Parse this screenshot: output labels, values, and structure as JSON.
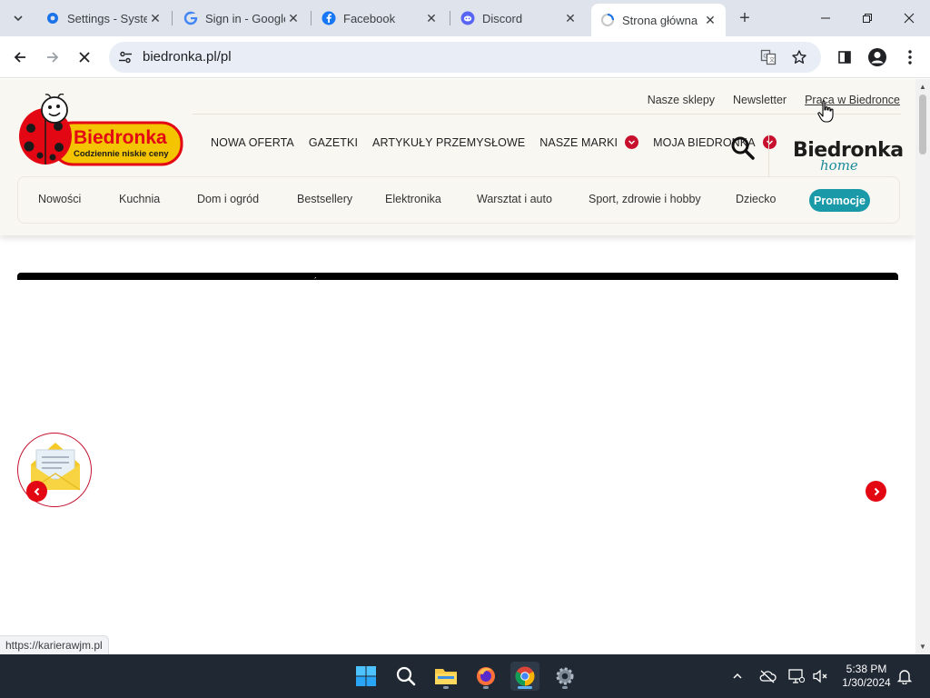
{
  "browser": {
    "tabs": [
      {
        "title": "Settings - System",
        "icon": "settings-gear-icon"
      },
      {
        "title": "Sign in - Google",
        "icon": "google-g-icon"
      },
      {
        "title": "Facebook",
        "icon": "facebook-icon"
      },
      {
        "title": "Discord",
        "icon": "discord-icon"
      },
      {
        "title": "Strona główna",
        "icon": "loading-favicon-icon",
        "active": true
      }
    ],
    "new_tab": "+",
    "url": "biedronka.pl/pl",
    "status_url": "https://karierawjm.pl"
  },
  "site": {
    "logo": {
      "brand": "Biedronka",
      "tagline": "Codziennie niskie ceny"
    },
    "util_links": [
      "Nasze sklepy",
      "Newsletter",
      "Praca w Biedronce"
    ],
    "main_nav": [
      {
        "label": "NOWA OFERTA",
        "dropdown": false
      },
      {
        "label": "GAZETKI",
        "dropdown": false
      },
      {
        "label": "ARTYKUŁY PRZEMYSŁOWE",
        "dropdown": false
      },
      {
        "label": "NASZE MARKI",
        "dropdown": true
      },
      {
        "label": "MOJA BIEDRONKA",
        "dropdown": true
      }
    ],
    "home_logo": {
      "brand": "Biedronka",
      "sub": "home"
    },
    "categories": [
      "Nowości",
      "Kuchnia",
      "Dom i ogród",
      "Bestsellery",
      "Elektronika",
      "Warsztat i auto",
      "Sport, zdrowie i hobby",
      "Dziecko"
    ],
    "promo_button": "Promocje",
    "banner_char": "´",
    "colors": {
      "brand_red": "#e30613",
      "teal": "#1a9aa8",
      "header_bg": "#f9f7f2"
    }
  },
  "taskbar": {
    "time": "5:38 PM",
    "date": "1/30/2024"
  }
}
